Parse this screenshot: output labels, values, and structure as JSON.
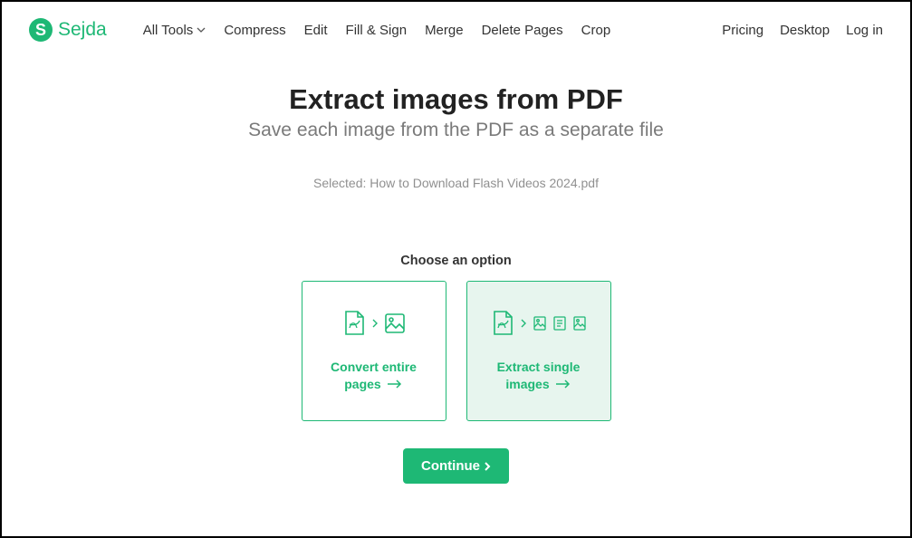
{
  "brand": {
    "logo_letter": "S",
    "name": "Sejda"
  },
  "nav": {
    "left": [
      "All Tools",
      "Compress",
      "Edit",
      "Fill & Sign",
      "Merge",
      "Delete Pages",
      "Crop"
    ],
    "right": [
      "Pricing",
      "Desktop",
      "Log in"
    ]
  },
  "page": {
    "title": "Extract images from PDF",
    "subtitle": "Save each image from the PDF as a separate file",
    "selected_label": "Selected: How to Download Flash Videos 2024.pdf",
    "choose_label": "Choose an option"
  },
  "options": {
    "convert": {
      "line1": "Convert entire",
      "line2": "pages"
    },
    "extract": {
      "line1": "Extract single",
      "line2": "images"
    }
  },
  "continue_label": "Continue",
  "colors": {
    "accent": "#1eb875"
  }
}
